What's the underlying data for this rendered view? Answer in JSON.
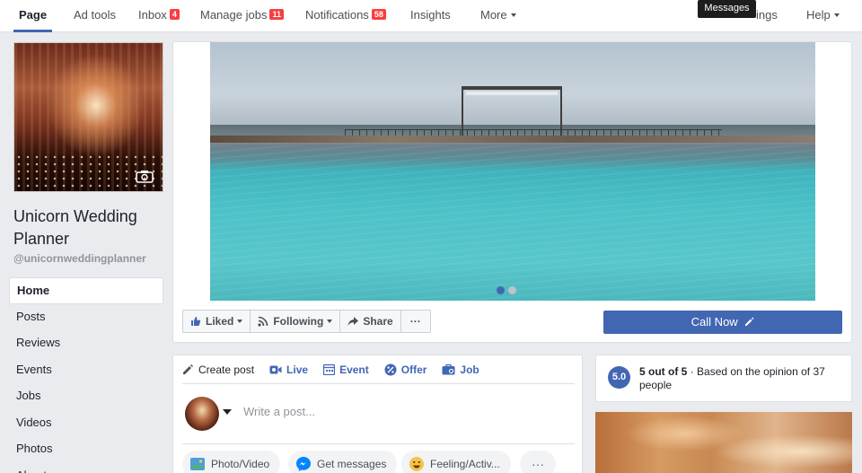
{
  "topnav": {
    "items": [
      {
        "label": "Page",
        "active": true
      },
      {
        "label": "Ad tools"
      },
      {
        "label": "Inbox",
        "badge": "4"
      },
      {
        "label": "Manage jobs",
        "badge": "11"
      },
      {
        "label": "Notifications",
        "badge": "58"
      },
      {
        "label": "Insights"
      },
      {
        "label": "More"
      }
    ],
    "settings_partial": "ings",
    "help": "Help",
    "tooltip": "Messages"
  },
  "profile": {
    "name": "Unicorn Wedding Planner",
    "handle": "@unicornweddingplanner"
  },
  "sidebar": {
    "items": [
      "Home",
      "Posts",
      "Reviews",
      "Events",
      "Jobs",
      "Videos",
      "Photos",
      "About"
    ],
    "active": "Home"
  },
  "actions": {
    "liked": "Liked",
    "following": "Following",
    "share": "Share",
    "more": "···",
    "call_now": "Call Now"
  },
  "composer": {
    "tabs": [
      "Create post",
      "Live",
      "Event",
      "Offer",
      "Job"
    ],
    "placeholder": "Write a post...",
    "pills": [
      "Photo/Video",
      "Get messages",
      "Feeling/Activ...",
      "···"
    ]
  },
  "rating": {
    "score": "5.0",
    "headline": "5 out of 5",
    "detail": "Based on the opinion of 37 people"
  },
  "colors": {
    "brand": "#4267b2",
    "badge": "#fa3e3e",
    "background": "#e9ebee"
  }
}
